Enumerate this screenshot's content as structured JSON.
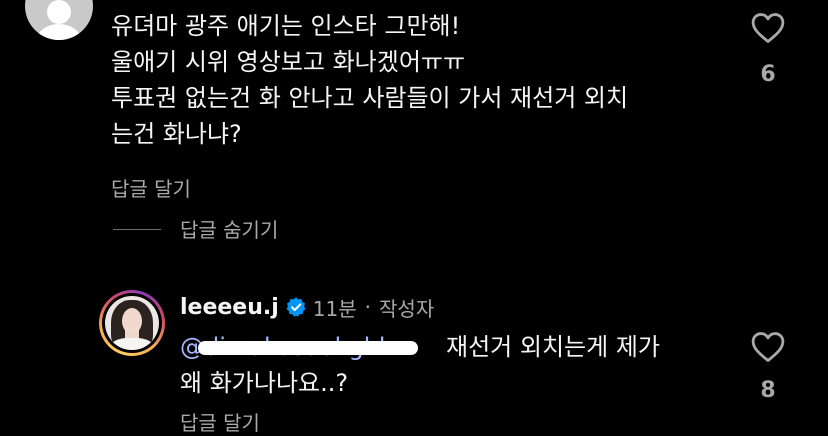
{
  "first_comment": {
    "lines": [
      "유뎌마 광주 애기는 인스타 그만해!",
      "울애기 시위 영상보고 화나겠어ㅠㅠ",
      "투표권 없는건 화 안나고 사람들이 가서 재선거 외치",
      "는건 화나냐?"
    ],
    "reply_label": "답글 달기",
    "like_count": "6",
    "avatar_icon": "default-profile-icon",
    "heart_icon": "heart-outline-icon"
  },
  "thread": {
    "hide_replies_label": "답글 숨기기"
  },
  "author_reply": {
    "username": "leeeeu.j",
    "verified_icon": "verified-badge-icon",
    "time": "11분",
    "separator": "·",
    "author_tag": "작성자",
    "mention": "@dimakasuokghk",
    "text_line_1": "재선거 외치는게 제가",
    "text_line_2": "왜 화가나나요..?",
    "reply_label": "답글 달기",
    "like_count": "8",
    "heart_icon": "heart-outline-icon"
  },
  "colors": {
    "background": "#000000",
    "text": "#f5f5f5",
    "secondary_text": "#a8a8a8",
    "mention": "#a6b8ff",
    "verified": "#0095f6"
  }
}
